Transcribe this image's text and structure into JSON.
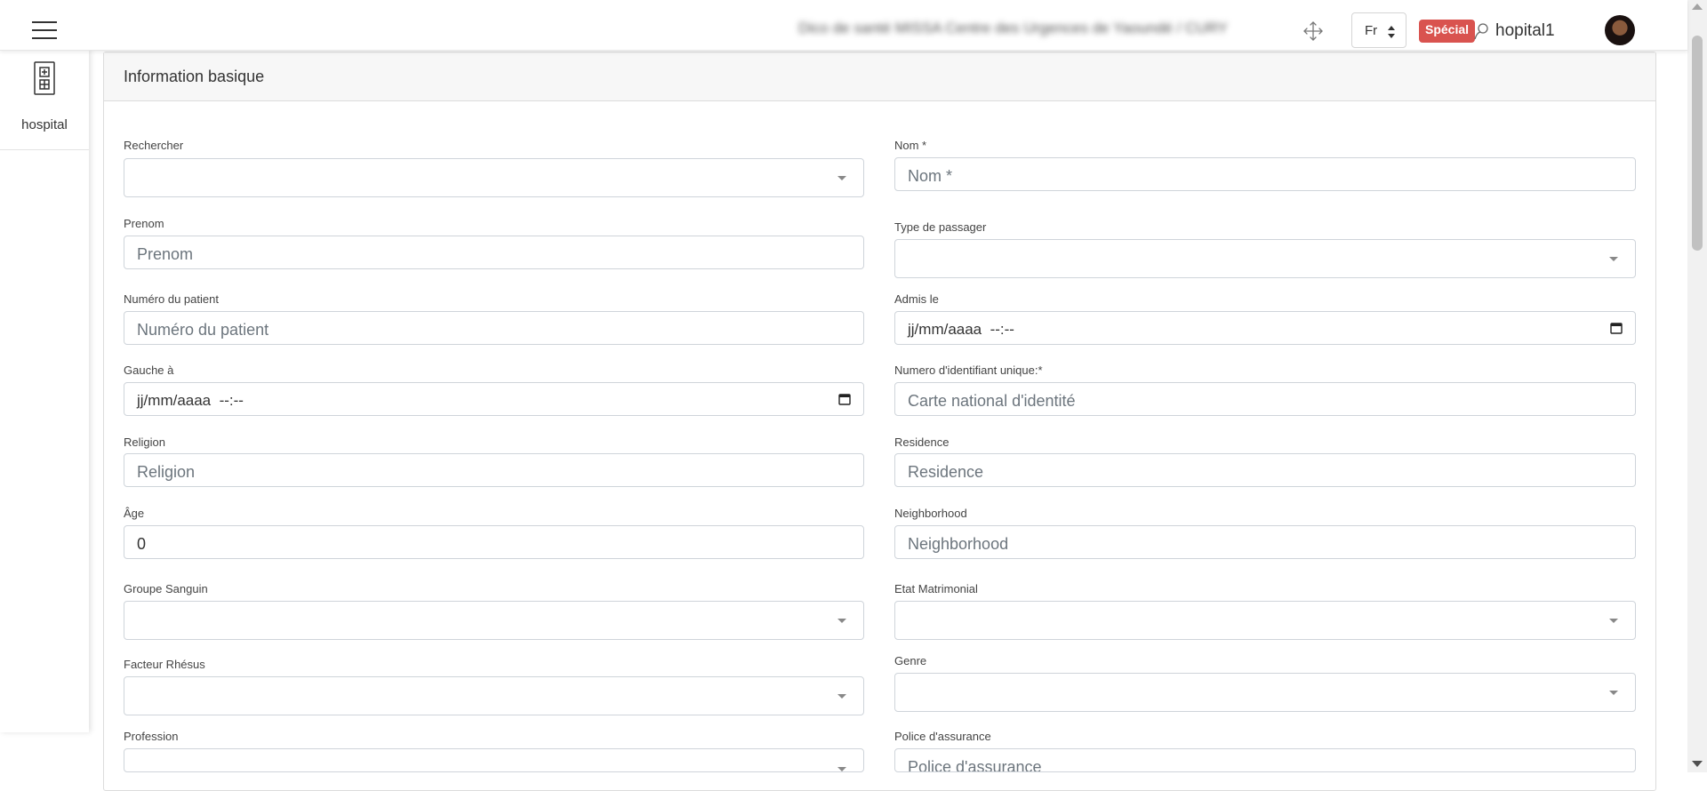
{
  "topbar": {
    "facility": "Dico de santé MISSA Centre des Urgences de Yaoundé / CURY",
    "language": "Fr",
    "badge": "Spécial",
    "username": "hopital1"
  },
  "sidebar": {
    "items": [
      {
        "label": "hospital",
        "icon": "hospital-icon"
      }
    ]
  },
  "card": {
    "title": "Information basique"
  },
  "form": {
    "rechercher": {
      "label": "Rechercher",
      "value": ""
    },
    "nom": {
      "label": "Nom *",
      "placeholder": "Nom *"
    },
    "prenom": {
      "label": "Prenom",
      "placeholder": "Prenom"
    },
    "type_passager": {
      "label": "Type de passager",
      "value": ""
    },
    "numero_patient": {
      "label": "Numéro du patient",
      "placeholder": "Numéro du patient"
    },
    "admis_le": {
      "label": "Admis le",
      "value": "jj/mm/aaaa  --:--"
    },
    "gauche_a": {
      "label": "Gauche à",
      "value": "jj/mm/aaaa  --:--"
    },
    "identifiant": {
      "label": "Numero d'identifiant unique:*",
      "placeholder": "Carte national d'identité"
    },
    "religion": {
      "label": "Religion",
      "placeholder": "Religion"
    },
    "residence": {
      "label": "Residence",
      "placeholder": "Residence"
    },
    "age": {
      "label": "Âge",
      "value": "0"
    },
    "neighborhood": {
      "label": "Neighborhood",
      "placeholder": "Neighborhood"
    },
    "groupe_sanguin": {
      "label": "Groupe Sanguin",
      "value": ""
    },
    "etat_matrimonial": {
      "label": "Etat Matrimonial",
      "value": ""
    },
    "facteur_rhesus": {
      "label": "Facteur Rhésus",
      "value": ""
    },
    "genre": {
      "label": "Genre",
      "value": ""
    },
    "profession": {
      "label": "Profession",
      "value": ""
    },
    "police_assurance": {
      "label": "Police d'assurance",
      "placeholder": "Police d'assurance"
    }
  }
}
